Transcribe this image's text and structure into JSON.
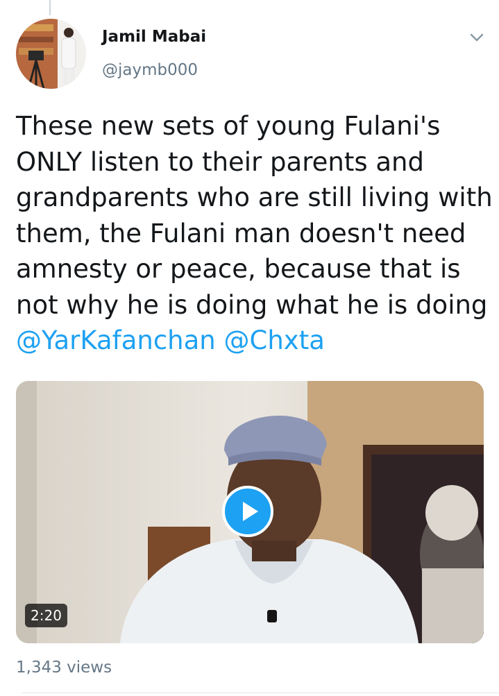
{
  "tweet": {
    "author_name": "Jamil Mabai",
    "author_handle": "@jaymb000",
    "text_lines": [
      "These new sets of young Fulani's",
      "ONLY listen to their parents and",
      "grandparents who are still living with",
      "them, the Fulani man doesn't need",
      "amnesty or peace, because that is",
      "not why he is doing what he is doing"
    ],
    "mentions": [
      "@YarKafanchan",
      "@Chxta"
    ],
    "media": {
      "duration": "2:20",
      "play_icon": "play-icon"
    },
    "views": "1,343 views"
  },
  "colors": {
    "accent": "#1da1f2",
    "text": "#14171a",
    "secondary": "#657786"
  },
  "icons": [
    "avatar",
    "chevron-down-icon",
    "play-icon"
  ]
}
